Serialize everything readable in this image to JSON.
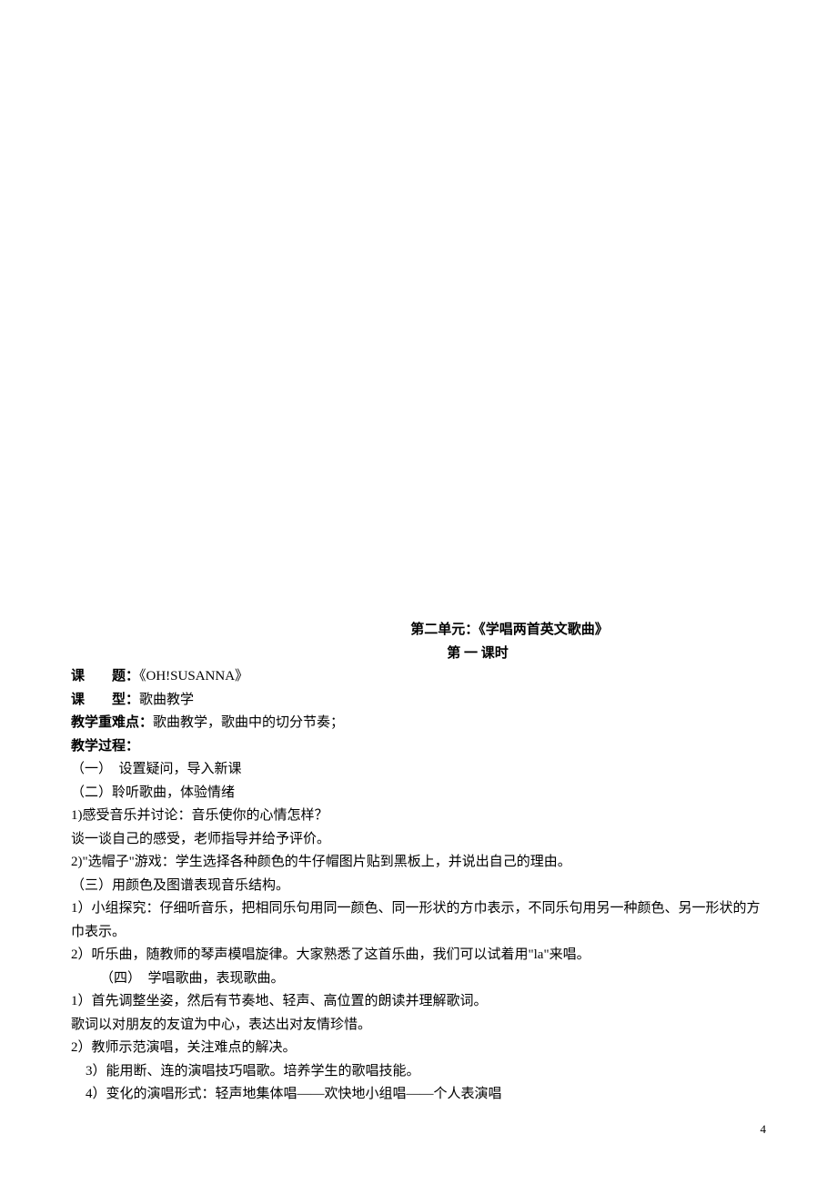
{
  "title": {
    "line1": "第二单元：《学唱两首英文歌曲》",
    "line2": "第 一 课时"
  },
  "meta": {
    "topic_label": "课　　题：",
    "topic_value": "《OH!SUSANNA》",
    "type_label": "课　　型：",
    "type_value": "歌曲教学",
    "difficulty_label": "教学重难点：",
    "difficulty_value": "歌曲教学，歌曲中的切分节奏；",
    "process_label": "教学过程："
  },
  "body": {
    "p1": "（一）　设置疑问，导入新课",
    "p2": "（二）聆听歌曲，体验情绪",
    "p3": "1)感受音乐并讨论：音乐使你的心情怎样？",
    "p4": "谈一谈自己的感受，老师指导并给予评价。",
    "p5": "2)\"选帽子\"游戏：学生选择各种颜色的牛仔帽图片贴到黑板上，并说出自己的理由。",
    "p6": "（三）用颜色及图谱表现音乐结构。",
    "p7": "1）小组探究：仔细听音乐，把相同乐句用同一颜色、同一形状的方巾表示，不同乐句用另一种颜色、另一形状的方巾表示。",
    "p8": "2）听乐曲，随教师的琴声模唱旋律。大家熟悉了这首乐曲，我们可以试着用\"la\"来唱。",
    "p9": "（四）　学唱歌曲，表现歌曲。",
    "p10": "1）首先调整坐姿，然后有节奏地、轻声、高位置的朗读并理解歌词。",
    "p11": "歌词以对朋友的友谊为中心，表达出对友情珍惜。",
    "p12": "2）教师示范演唱，关注难点的解决。",
    "p13": "3）能用断、连的演唱技巧唱歌。培养学生的歌唱技能。",
    "p14": "4）变化的演唱形式：轻声地集体唱——欢快地小组唱——个人表演唱"
  },
  "page_number": "4"
}
